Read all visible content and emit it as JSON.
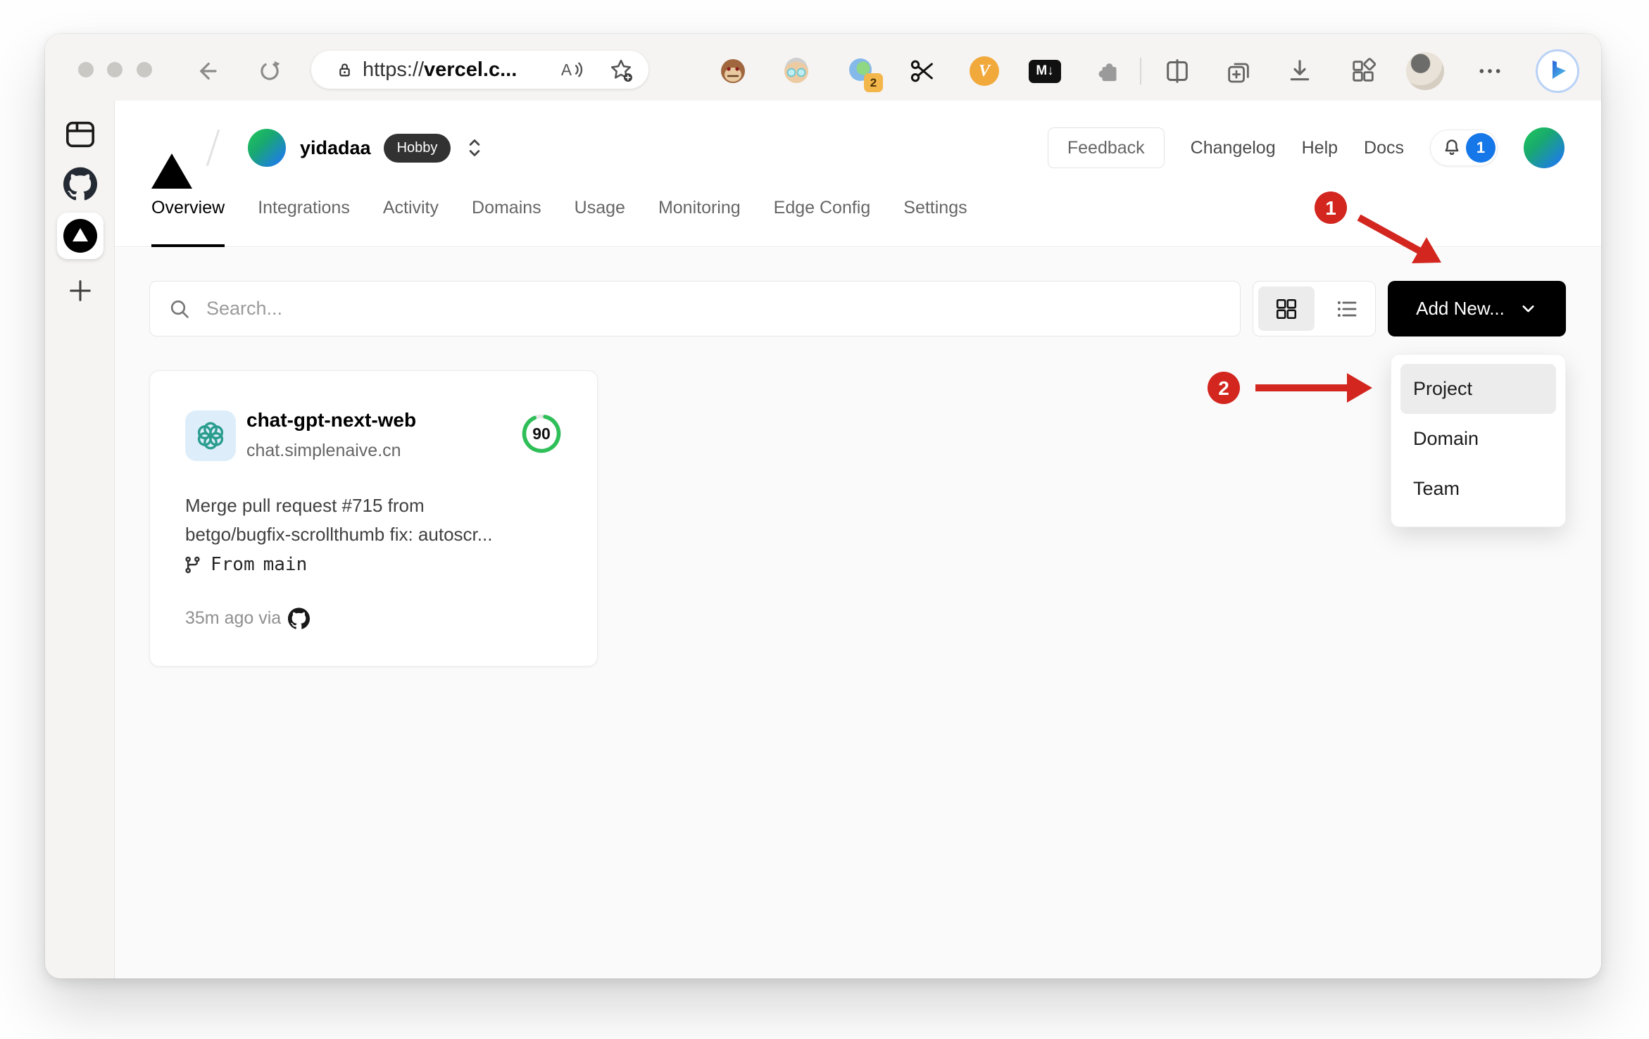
{
  "browser": {
    "url": {
      "protocol": "https://",
      "domain": "vercel.c..."
    },
    "extensions": {
      "proxy_badge_count": "2",
      "v_label": "V",
      "markdown_label": "M↓"
    }
  },
  "header": {
    "team_name": "yidadaa",
    "plan_badge": "Hobby",
    "feedback_label": "Feedback",
    "links": {
      "changelog": "Changelog",
      "help": "Help",
      "docs": "Docs"
    },
    "notification_count": "1"
  },
  "tabs": [
    {
      "label": "Overview",
      "active": true
    },
    {
      "label": "Integrations",
      "active": false
    },
    {
      "label": "Activity",
      "active": false
    },
    {
      "label": "Domains",
      "active": false
    },
    {
      "label": "Usage",
      "active": false
    },
    {
      "label": "Monitoring",
      "active": false
    },
    {
      "label": "Edge Config",
      "active": false
    },
    {
      "label": "Settings",
      "active": false
    }
  ],
  "controls": {
    "search_placeholder": "Search...",
    "add_new_label": "Add New..."
  },
  "dropdown": {
    "items": [
      "Project",
      "Domain",
      "Team"
    ],
    "highlighted": "Project"
  },
  "project_card": {
    "name": "chat-gpt-next-web",
    "domain": "chat.simplenaive.cn",
    "score": "90",
    "commit_line1": "Merge pull request #715 from",
    "commit_line2": "betgo/bugfix-scrollthumb fix: autoscr...",
    "branch_prefix": "From",
    "branch_name": "main",
    "deployed_info": "35m ago via"
  },
  "annotations": {
    "step1": "1",
    "step2": "2"
  },
  "colors": {
    "accent_blue": "#1677e9",
    "annotation_red": "#d2261f",
    "score_green": "#2fbf58",
    "brand_black": "#000000"
  }
}
